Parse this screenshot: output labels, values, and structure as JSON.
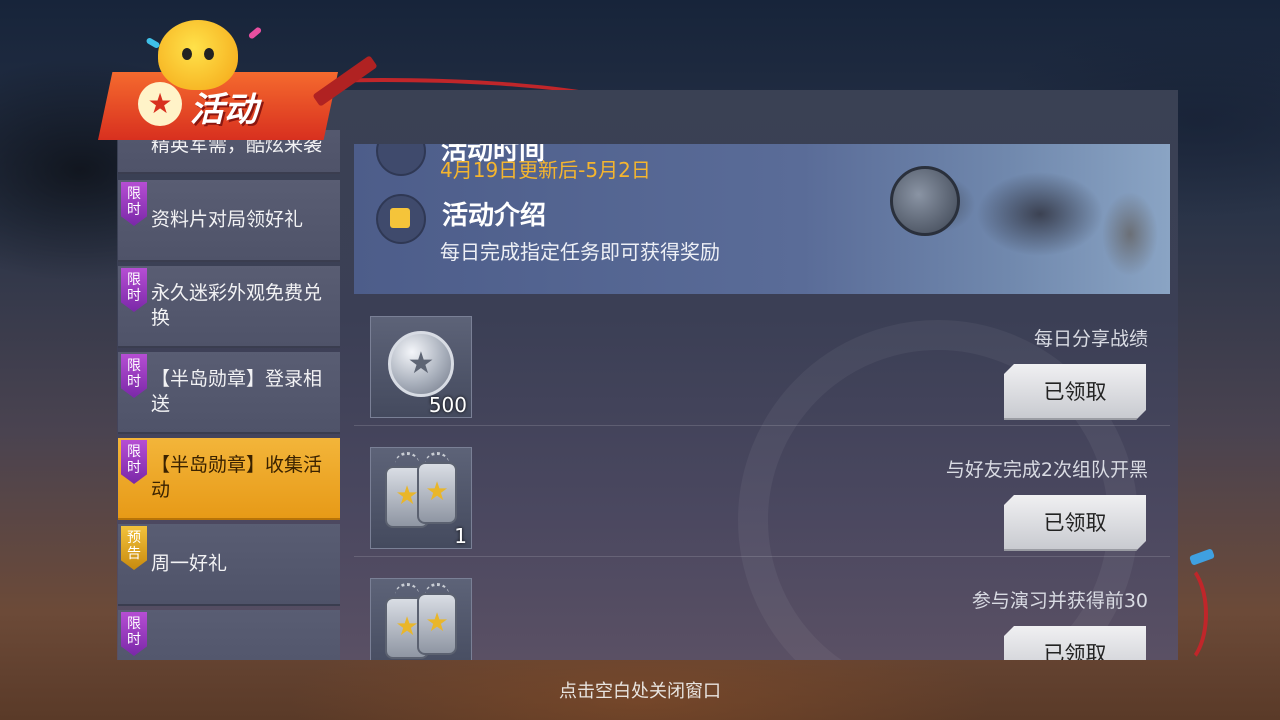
{
  "header": {
    "logo_text": "活动",
    "logo_mark": "★"
  },
  "sidebar": {
    "items": [
      {
        "label": "精英军需，酷炫来袭",
        "badge": ""
      },
      {
        "label": "资料片对局领好礼",
        "badge": "限时"
      },
      {
        "label": "永久迷彩外观免费兑换",
        "badge": "限时"
      },
      {
        "label": "【半岛勋章】登录相送",
        "badge": "限时"
      },
      {
        "label": "【半岛勋章】收集活动",
        "badge": "限时",
        "active": true
      },
      {
        "label": "周一好礼",
        "badge": "预告"
      },
      {
        "label": "",
        "badge": "限时"
      }
    ]
  },
  "banner": {
    "time_title": "活动时间",
    "date": "4月19日更新后-5月2日",
    "intro_title": "活动介绍",
    "intro_desc": "每日完成指定任务即可获得奖励"
  },
  "tasks": [
    {
      "desc": "每日分享战绩",
      "reward_icon": "silver-coin-icon",
      "reward_count": "500",
      "button": "已领取"
    },
    {
      "desc": "与好友完成2次组队开黑",
      "reward_icon": "dog-tag-icon",
      "reward_count": "1",
      "button": "已领取"
    },
    {
      "desc": "参与演习并获得前30",
      "reward_icon": "dog-tag-icon",
      "reward_count": "",
      "button": "已领取"
    }
  ],
  "footer": {
    "hint": "点击空白处关闭窗口"
  },
  "colors": {
    "accent_gold": "#f5b52e",
    "active_tab": "#f3b53a",
    "badge_purple": "#b64ed4",
    "logo_red": "#d8301f"
  }
}
